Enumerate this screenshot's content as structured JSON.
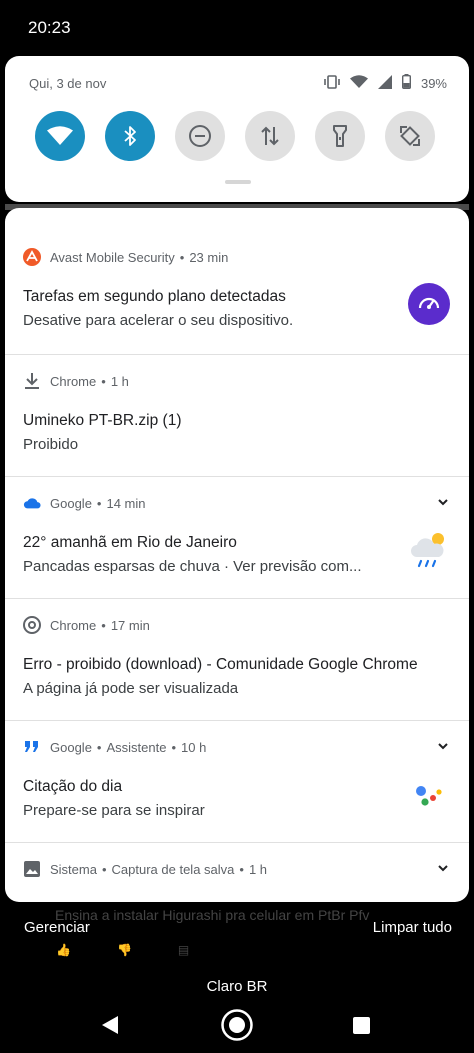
{
  "status_bar": {
    "time": "20:23"
  },
  "quick_settings": {
    "date": "Qui, 3 de nov",
    "battery": "39%",
    "tiles": [
      {
        "name": "wifi",
        "active": true
      },
      {
        "name": "bluetooth",
        "active": true
      },
      {
        "name": "do-not-disturb",
        "active": false
      },
      {
        "name": "mobile-data",
        "active": false
      },
      {
        "name": "flashlight",
        "active": false
      },
      {
        "name": "auto-rotate",
        "active": false
      }
    ]
  },
  "notifications": [
    {
      "app": "Avast Mobile Security",
      "meta": "23 min",
      "title": "Tarefas em segundo plano detectadas",
      "body": "Desative para acelerar o seu dispositivo."
    },
    {
      "app": "Chrome",
      "meta": "1 h",
      "title": "Umineko PT-BR.zip (1)",
      "body": "Proibido"
    },
    {
      "app": "Google",
      "meta": "14 min",
      "title": "22° amanhã em Rio de Janeiro",
      "body": "Pancadas esparsas de chuva · Ver previsão com..."
    },
    {
      "app": "Chrome",
      "meta": "17 min",
      "title": "Erro - proibido (download) - Comunidade Google Chrome",
      "body": "A página já pode ser visualizada"
    },
    {
      "app": "Google",
      "sub": "Assistente",
      "meta": "10 h",
      "title": "Citação do dia",
      "body": "Prepare-se para se inspirar"
    },
    {
      "app": "Sistema",
      "sub": "Captura de tela salva",
      "meta": "1 h"
    }
  ],
  "footer": {
    "manage": "Gerenciar",
    "clear_all": "Limpar tudo",
    "behind_text": "Ensina a instalar Higurashi pra celular em PtBr Pfv"
  },
  "carrier": "Claro BR",
  "colors": {
    "accent": "#1a8fc0",
    "avast": "#f05a28",
    "boost": "#5b2ccc"
  }
}
